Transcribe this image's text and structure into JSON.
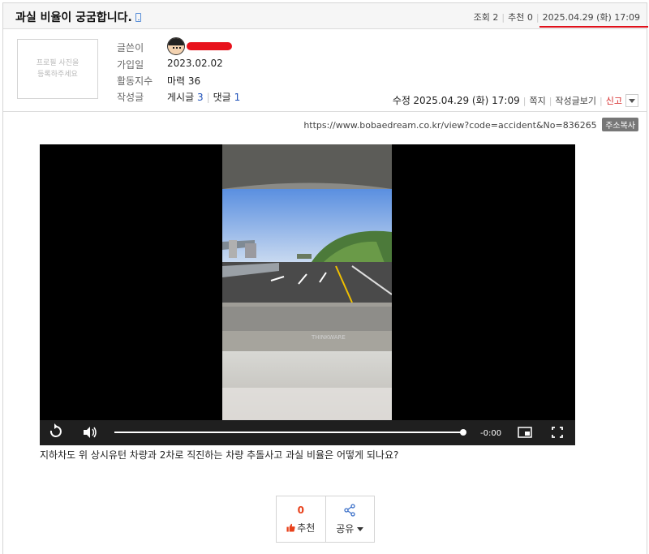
{
  "post": {
    "title": "과실 비율이 궁굼합니다."
  },
  "stats": {
    "views_label": "조회",
    "views": "2",
    "recommend_label": "추천",
    "recommend": "0",
    "date": "2025.04.29 (화) 17:09"
  },
  "profile": {
    "photo_line1": "프로필 사진을",
    "photo_line2": "등록하주세요",
    "author_label": "글쓴이",
    "joined_label": "가입일",
    "joined": "2023.02.02",
    "activity_label": "활동지수",
    "activity": "마력 36",
    "posts_label": "작성글",
    "posts_text": "게시글",
    "posts_count": "3",
    "comments_text": "댓글",
    "comments_count": "1"
  },
  "meta": {
    "modified_label": "수정",
    "modified_date": "2025.04.29 (화) 17:09",
    "message": "쪽지",
    "view_posts": "작성글보기",
    "report": "신고"
  },
  "url": {
    "text": "https://www.bobaedream.co.kr/view?code=accident&No=836265",
    "copy_label": "주소복사"
  },
  "video": {
    "watermark": "THINKWARE",
    "time": "-0:00",
    "progress": 1.0
  },
  "caption": "지하차도 위 상시유턴 차량과 2차로 직진하는 차량 추돌사고 과실 비율은 어떻게 되나요?",
  "actions": {
    "recommend_count": "0",
    "recommend_label": "추천",
    "share_label": "공유"
  },
  "colors": {
    "highlight": "#e0101a",
    "link_blue": "#1c4fb8",
    "report_red": "#d62828",
    "recommend_orange": "#e8401a"
  }
}
